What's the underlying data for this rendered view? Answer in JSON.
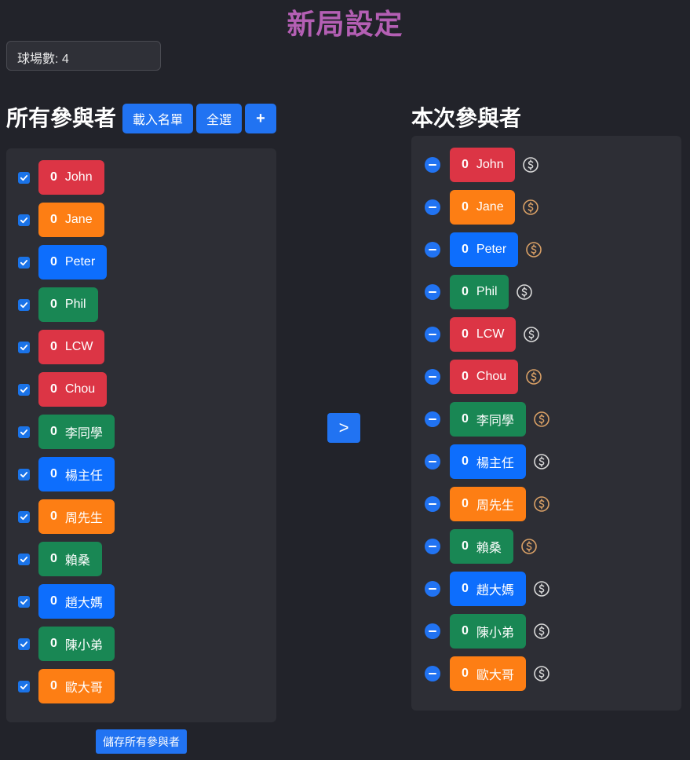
{
  "header": {
    "title": "新局設定"
  },
  "courts": {
    "label": "球場數: 4"
  },
  "left": {
    "title": "所有參與者",
    "load_label": "載入名單",
    "select_all_label": "全選",
    "add_label": "+",
    "save_label": "儲存所有參與者",
    "players": [
      {
        "score": "0",
        "name": "John",
        "color": "#dc3545",
        "checked": true
      },
      {
        "score": "0",
        "name": "Jane",
        "color": "#fd7e14",
        "checked": true
      },
      {
        "score": "0",
        "name": "Peter",
        "color": "#0d6efd",
        "checked": true
      },
      {
        "score": "0",
        "name": "Phil",
        "color": "#198754",
        "checked": true
      },
      {
        "score": "0",
        "name": "LCW",
        "color": "#dc3545",
        "checked": true
      },
      {
        "score": "0",
        "name": "Chou",
        "color": "#dc3545",
        "checked": true
      },
      {
        "score": "0",
        "name": "李同學",
        "color": "#198754",
        "checked": true
      },
      {
        "score": "0",
        "name": "楊主任",
        "color": "#0d6efd",
        "checked": true
      },
      {
        "score": "0",
        "name": "周先生",
        "color": "#fd7e14",
        "checked": true
      },
      {
        "score": "0",
        "name": "賴桑",
        "color": "#198754",
        "checked": true
      },
      {
        "score": "0",
        "name": "趙大媽",
        "color": "#0d6efd",
        "checked": true
      },
      {
        "score": "0",
        "name": "陳小弟",
        "color": "#198754",
        "checked": true
      },
      {
        "score": "0",
        "name": "歐大哥",
        "color": "#fd7e14",
        "checked": true
      }
    ]
  },
  "transfer": {
    "label": ">"
  },
  "right": {
    "title": "本次參與者",
    "players": [
      {
        "score": "0",
        "name": "John",
        "color": "#dc3545",
        "coin": "dollar-coin-icon",
        "coin_color": "#d9d9d9"
      },
      {
        "score": "0",
        "name": "Jane",
        "color": "#fd7e14",
        "coin": "dollar-coin-icon",
        "coin_color": "#d9a066"
      },
      {
        "score": "0",
        "name": "Peter",
        "color": "#0d6efd",
        "coin": "dollar-coin-icon",
        "coin_color": "#d9a066"
      },
      {
        "score": "0",
        "name": "Phil",
        "color": "#198754",
        "coin": "dollar-coin-icon",
        "coin_color": "#d9d9d9"
      },
      {
        "score": "0",
        "name": "LCW",
        "color": "#dc3545",
        "coin": "dollar-coin-icon",
        "coin_color": "#d9d9d9"
      },
      {
        "score": "0",
        "name": "Chou",
        "color": "#dc3545",
        "coin": "dollar-coin-icon",
        "coin_color": "#d9a066"
      },
      {
        "score": "0",
        "name": "李同學",
        "color": "#198754",
        "coin": "dollar-coin-icon",
        "coin_color": "#d9a066"
      },
      {
        "score": "0",
        "name": "楊主任",
        "color": "#0d6efd",
        "coin": "dollar-coin-icon",
        "coin_color": "#d9d9d9"
      },
      {
        "score": "0",
        "name": "周先生",
        "color": "#fd7e14",
        "coin": "dollar-coin-icon",
        "coin_color": "#d9a066"
      },
      {
        "score": "0",
        "name": "賴桑",
        "color": "#198754",
        "coin": "dollar-coin-icon",
        "coin_color": "#d9a066"
      },
      {
        "score": "0",
        "name": "趙大媽",
        "color": "#0d6efd",
        "coin": "dollar-coin-icon",
        "coin_color": "#d9d9d9"
      },
      {
        "score": "0",
        "name": "陳小弟",
        "color": "#198754",
        "coin": "dollar-coin-icon",
        "coin_color": "#d9d9d9"
      },
      {
        "score": "0",
        "name": "歐大哥",
        "color": "#fd7e14",
        "coin": "dollar-coin-icon",
        "coin_color": "#d9d9d9"
      }
    ]
  }
}
